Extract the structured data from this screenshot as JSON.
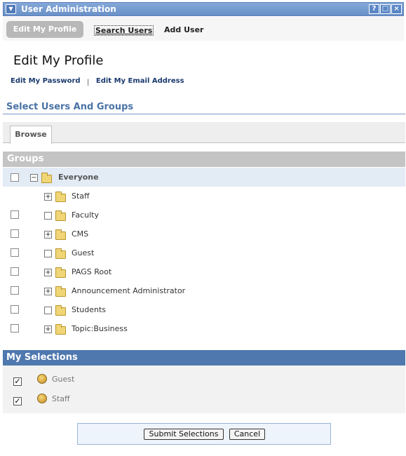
{
  "window": {
    "title": "User Administration"
  },
  "nav": {
    "edit_profile": "Edit My Profile",
    "search_users": "Search Users",
    "add_user": "Add User"
  },
  "page": {
    "title": "Edit My Profile",
    "link_password": "Edit My Password",
    "separator": "|",
    "link_email": "Edit My Email Address"
  },
  "select": {
    "heading": "Select Users And Groups",
    "tab_browse": "Browse"
  },
  "groups": {
    "header": "Groups",
    "root": "Everyone",
    "items": [
      "Staff",
      "Faculty",
      "CMS",
      "Guest",
      "PAGS Root",
      "Announcement Administrator",
      "Students",
      "Topic:Business"
    ]
  },
  "selections": {
    "header": "My Selections",
    "items": [
      "Guest",
      "Staff"
    ]
  },
  "buttons": {
    "submit": "Submit Selections",
    "cancel": "Cancel"
  }
}
